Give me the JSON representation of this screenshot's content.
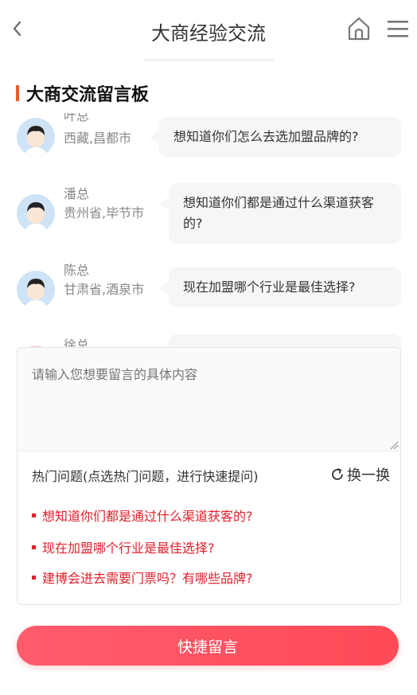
{
  "header": {
    "title": "大商经验交流",
    "back_icon": "chevron-left-icon",
    "home_icon": "home-icon",
    "menu_icon": "hamburger-menu-icon"
  },
  "section": {
    "title": "大商交流留言板",
    "accent_color": "#f05a24"
  },
  "messages": [
    {
      "name": "叶总",
      "location": "西藏,昌都市",
      "text": "想知道你们怎么去选加盟品牌的?"
    },
    {
      "name": "潘总",
      "location": "贵州省,毕节市",
      "text": "想知道你们都是通过什么渠道获客的?"
    },
    {
      "name": "陈总",
      "location": "甘肃省,酒泉市",
      "text": "现在加盟哪个行业是最佳选择?"
    },
    {
      "name": "徐总",
      "location": "",
      "text": ""
    }
  ],
  "form": {
    "placeholder": "请输入您想要留言的具体内容",
    "hot_label": "热门问题(点选热门问题，进行快速提问)",
    "refresh_label": "换一换",
    "hot_questions": [
      "想知道你们都是通过什么渠道获客的?",
      "现在加盟哪个行业是最佳选择?",
      "建博会进去需要门票吗？有哪些品牌?"
    ],
    "hot_color": "#e0202c"
  },
  "submit_label": "快捷留言",
  "submit_color": "#ff4f5c"
}
